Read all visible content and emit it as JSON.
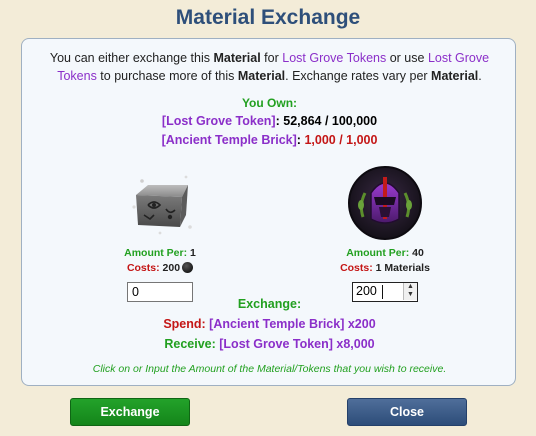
{
  "dialog": {
    "title": "Material Exchange"
  },
  "intro": {
    "p1": "You can either exchange this ",
    "material1": "Material",
    "p2": " for ",
    "token1": "Lost Grove Tokens",
    "p3": " or use ",
    "token2": "Lost Grove Tokens",
    "p4": " to purchase more of this ",
    "material2": "Material",
    "p5": ". Exchange rates vary per ",
    "material3": "Material",
    "p6": "."
  },
  "own": {
    "title": "You Own:",
    "token_name": "[Lost Grove Token]",
    "token_sep": ":",
    "token_value": " 52,864 / 100,000",
    "brick_name": "[Ancient Temple Brick]",
    "brick_sep": ":",
    "brick_value": " 1,000 / 1,000"
  },
  "left_item": {
    "icon": "ancient-temple-brick-icon",
    "amount_label": "Amount Per:",
    "amount_value": " 1",
    "costs_label": "Costs:",
    "costs_value": " 200",
    "cost_icon": "token-coin-icon",
    "input_value": "0"
  },
  "right_item": {
    "icon": "lost-grove-token-icon",
    "amount_label": "Amount Per:",
    "amount_value": " 40",
    "costs_label": "Costs:",
    "costs_value": " 1 Materials",
    "input_value": "200"
  },
  "exchange": {
    "title": "Exchange:",
    "spend_label": "Spend:",
    "spend_value": " [Ancient Temple Brick] x200",
    "receive_label": "Receive:",
    "receive_value": " [Lost Grove Token] x8,000"
  },
  "hint": "Click on or Input the Amount of the Material/Tokens that you wish to receive.",
  "buttons": {
    "exchange": "Exchange",
    "close": "Close"
  },
  "colors": {
    "title": "#2e4f7a",
    "purple": "#8b2fc9",
    "green": "#22a020",
    "red": "#c41616",
    "exchange_button": "#14851a",
    "close_button": "#2d4d79"
  }
}
